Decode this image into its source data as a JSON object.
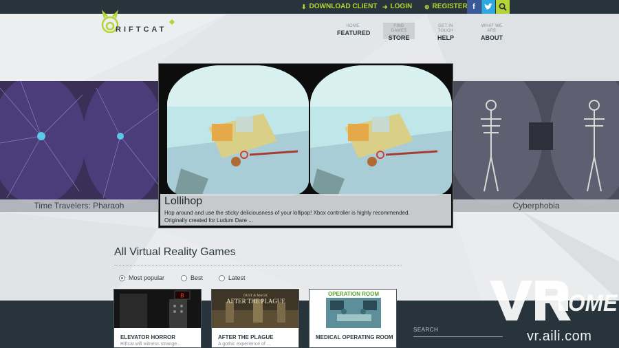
{
  "topbar": {
    "download_label": "DOWNLOAD CLIENT",
    "login_label": "LOGIN",
    "register_label": "REGISTER"
  },
  "logo": {
    "text": "RIFTCAT"
  },
  "nav": [
    {
      "small": "HOME",
      "big": "FEATURED"
    },
    {
      "small": "FIND GAMES",
      "big": "STORE"
    },
    {
      "small": "GET IN TOUCH",
      "big": "HELP"
    },
    {
      "small": "WHAT WE ARE",
      "big": "ABOUT"
    }
  ],
  "carousel": {
    "left_caption": "Time Travelers: Pharaoh",
    "right_caption": "Cyberphobia",
    "main_title": "Lollihop",
    "main_description": "Hop around and use the sticky deliciousness of your lollipop! Xbox controller is highly recommended. Originally created for Ludum Dare ..."
  },
  "games_section": {
    "title": "All Virtual Reality Games",
    "sort_options": [
      "Most popular",
      "Best",
      "Latest"
    ],
    "selected_sort": "Most popular"
  },
  "games": [
    {
      "name": "ELEVATOR HORROR",
      "desc": "Riftcat will witness strange...",
      "thumb_label": "B"
    },
    {
      "name": "AFTER THE PLAGUE",
      "desc": "A gothic experience of ...",
      "thumb_label": "AFTER THE PLAGUE",
      "thumb_small": "DUST & MAGIC"
    },
    {
      "name": "MEDICAL OPERATING ROOM",
      "desc": "",
      "thumb_label": "OPERATION ROOM"
    }
  ],
  "sidebar": {
    "search_label": "SEARCH"
  },
  "watermark": {
    "brand": "VR HOME",
    "url": "vr.aili.com"
  },
  "colors": {
    "accent": "#b4d334",
    "dark": "#27343b",
    "facebook": "#3b5998",
    "twitter": "#2fa8e0"
  }
}
